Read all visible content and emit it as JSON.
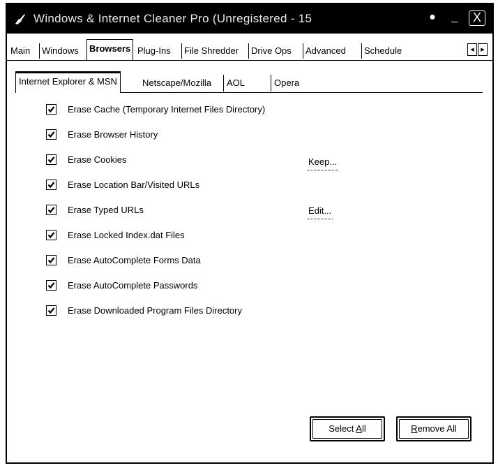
{
  "window": {
    "title": "Windows & Internet Cleaner Pro (Unregistered - 15",
    "min_glyph": "_",
    "close_glyph": "X"
  },
  "tabs": [
    "Main",
    "Windows",
    "Browsers",
    "Plug-Ins",
    "File Shredder",
    "Drive Ops",
    "Advanced",
    "Schedule"
  ],
  "tab_scroll": {
    "left": "◂",
    "right": "▸"
  },
  "subtabs": [
    "Internet Explorer & MSN",
    "Netscape/Mozilla",
    "AOL",
    "Opera"
  ],
  "options": [
    {
      "label": "Erase Cache (Temporary Internet Files Directory)",
      "checked": true
    },
    {
      "label": "Erase Browser History",
      "checked": true
    },
    {
      "label": "Erase Cookies",
      "checked": true
    },
    {
      "label": "Erase Location Bar/Visited URLs",
      "checked": true
    },
    {
      "label": "Erase Typed URLs",
      "checked": true
    },
    {
      "label": "Erase Locked Index.dat Files",
      "checked": true
    },
    {
      "label": "Erase AutoComplete Forms Data",
      "checked": true
    },
    {
      "label": "Erase AutoComplete Passwords",
      "checked": true
    },
    {
      "label": "Erase Downloaded Program Files Directory",
      "checked": true
    }
  ],
  "actions": {
    "keep_label": "Keep...",
    "edit_label": "Edit...",
    "select_all_pre": "Select ",
    "select_all_u": "A",
    "select_all_post": "ll",
    "remove_all_u": "R",
    "remove_all_post": "emove All"
  }
}
